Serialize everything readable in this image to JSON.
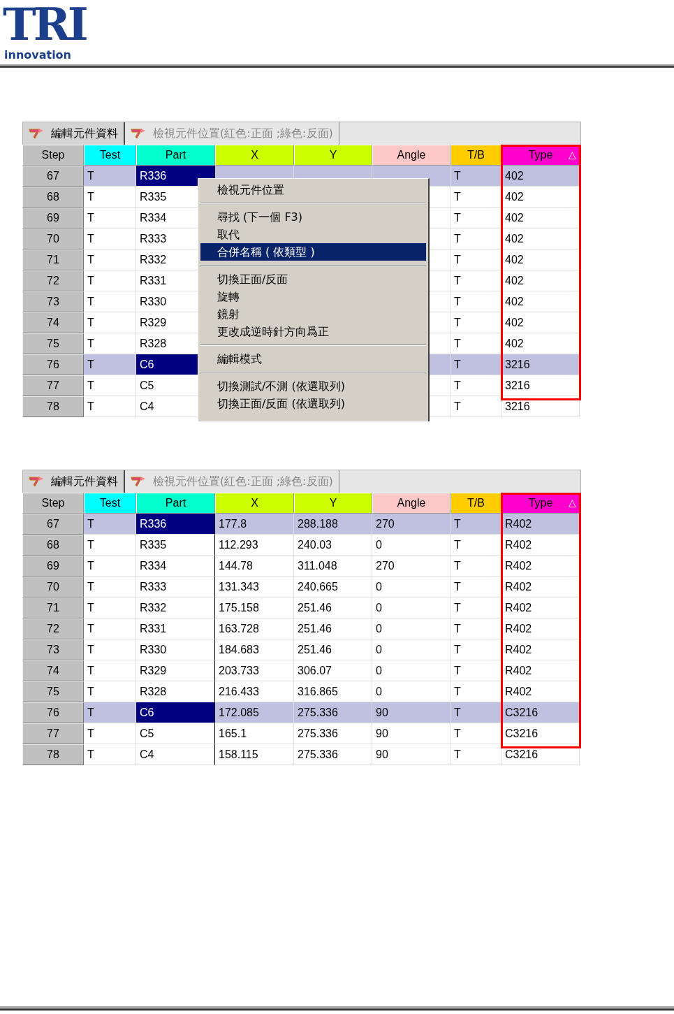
{
  "logo": {
    "mark": "TRI",
    "subtitle": "innovation"
  },
  "panels": [
    {
      "tabs": [
        {
          "label": "編輯元件資料",
          "selected": true
        },
        {
          "label": "檢視元件位置(紅色:正面 ;綠色:反面)",
          "selected": false
        }
      ],
      "columns": [
        {
          "label": "Step",
          "color": "#c0c0c0",
          "highlighted": false
        },
        {
          "label": "Test",
          "color": "#00ffff",
          "highlighted": false
        },
        {
          "label": "Part",
          "color": "#00ffcc",
          "highlighted": false
        },
        {
          "label": "X",
          "color": "#ccff00",
          "highlighted": false
        },
        {
          "label": "Y",
          "color": "#ccff00",
          "highlighted": false
        },
        {
          "label": "Angle",
          "color": "#ffc8c8",
          "highlighted": false
        },
        {
          "label": "T/B",
          "color": "#ffcc00",
          "highlighted": false
        },
        {
          "label": "Type",
          "color": "#ff00cc",
          "highlighted": true,
          "sort_mark": "△"
        }
      ],
      "rows": [
        {
          "selected": true,
          "cells": [
            "67",
            "T",
            "R336",
            "",
            "",
            "",
            "T",
            "402"
          ]
        },
        {
          "selected": false,
          "cells": [
            "68",
            "T",
            "R335",
            "",
            "",
            "",
            "T",
            "402"
          ]
        },
        {
          "selected": false,
          "cells": [
            "69",
            "T",
            "R334",
            "",
            "",
            "",
            "T",
            "402"
          ]
        },
        {
          "selected": false,
          "cells": [
            "70",
            "T",
            "R333",
            "",
            "",
            "",
            "T",
            "402"
          ]
        },
        {
          "selected": false,
          "cells": [
            "71",
            "T",
            "R332",
            "",
            "",
            "",
            "T",
            "402"
          ]
        },
        {
          "selected": false,
          "cells": [
            "72",
            "T",
            "R331",
            "",
            "",
            "",
            "T",
            "402"
          ]
        },
        {
          "selected": false,
          "cells": [
            "73",
            "T",
            "R330",
            "",
            "",
            "",
            "T",
            "402"
          ]
        },
        {
          "selected": false,
          "cells": [
            "74",
            "T",
            "R329",
            "",
            "",
            "",
            "T",
            "402"
          ]
        },
        {
          "selected": false,
          "cells": [
            "75",
            "T",
            "R328",
            "",
            "",
            "",
            "T",
            "402"
          ]
        },
        {
          "selected": true,
          "cells": [
            "76",
            "T",
            "C6",
            "",
            "",
            "",
            "T",
            "3216"
          ]
        },
        {
          "selected": false,
          "cells": [
            "77",
            "T",
            "C5",
            "",
            "",
            "",
            "T",
            "3216"
          ]
        },
        {
          "selected": false,
          "cells": [
            "78",
            "T",
            "C4",
            "",
            "",
            "",
            "T",
            "3216"
          ]
        }
      ],
      "context_menu": {
        "items": [
          {
            "kind": "item",
            "label": "檢視元件位置",
            "selected": false
          },
          {
            "kind": "separator"
          },
          {
            "kind": "item",
            "label": "尋找 (下一個  F3)",
            "selected": false
          },
          {
            "kind": "item",
            "label": "取代",
            "selected": false
          },
          {
            "kind": "item",
            "label": "合併名稱 ( 依類型 )",
            "selected": true
          },
          {
            "kind": "separator"
          },
          {
            "kind": "item",
            "label": "切換正面/反面",
            "selected": false
          },
          {
            "kind": "item",
            "label": "旋轉",
            "selected": false
          },
          {
            "kind": "item",
            "label": "鏡射",
            "selected": false
          },
          {
            "kind": "item",
            "label": "更改成逆時針方向爲正",
            "selected": false
          },
          {
            "kind": "separator"
          },
          {
            "kind": "item",
            "label": "編輯模式",
            "selected": false
          },
          {
            "kind": "separator"
          },
          {
            "kind": "item",
            "label": "切換測試/不測 (依選取列)",
            "selected": false
          },
          {
            "kind": "item",
            "label": "切換正面/反面 (依選取列)",
            "selected": false
          }
        ]
      }
    },
    {
      "tabs": [
        {
          "label": "編輯元件資料",
          "selected": true
        },
        {
          "label": "檢視元件位置(紅色:正面 ;綠色:反面)",
          "selected": false
        }
      ],
      "columns": [
        {
          "label": "Step",
          "color": "#c0c0c0",
          "highlighted": false
        },
        {
          "label": "Test",
          "color": "#00ffff",
          "highlighted": false
        },
        {
          "label": "Part",
          "color": "#00ffcc",
          "highlighted": false
        },
        {
          "label": "X",
          "color": "#ccff00",
          "highlighted": false
        },
        {
          "label": "Y",
          "color": "#ccff00",
          "highlighted": false
        },
        {
          "label": "Angle",
          "color": "#ffc8c8",
          "highlighted": false
        },
        {
          "label": "T/B",
          "color": "#ffcc00",
          "highlighted": false
        },
        {
          "label": "Type",
          "color": "#ff00cc",
          "highlighted": true,
          "sort_mark": "△"
        }
      ],
      "rows": [
        {
          "selected": true,
          "cells": [
            "67",
            "T",
            "R336",
            "177.8",
            "288.188",
            "270",
            "T",
            "R402"
          ]
        },
        {
          "selected": false,
          "cells": [
            "68",
            "T",
            "R335",
            "112.293",
            "240.03",
            "0",
            "T",
            "R402"
          ]
        },
        {
          "selected": false,
          "cells": [
            "69",
            "T",
            "R334",
            "144.78",
            "311.048",
            "270",
            "T",
            "R402"
          ]
        },
        {
          "selected": false,
          "cells": [
            "70",
            "T",
            "R333",
            "131.343",
            "240.665",
            "0",
            "T",
            "R402"
          ]
        },
        {
          "selected": false,
          "cells": [
            "71",
            "T",
            "R332",
            "175.158",
            "251.46",
            "0",
            "T",
            "R402"
          ]
        },
        {
          "selected": false,
          "cells": [
            "72",
            "T",
            "R331",
            "163.728",
            "251.46",
            "0",
            "T",
            "R402"
          ]
        },
        {
          "selected": false,
          "cells": [
            "73",
            "T",
            "R330",
            "184.683",
            "251.46",
            "0",
            "T",
            "R402"
          ]
        },
        {
          "selected": false,
          "cells": [
            "74",
            "T",
            "R329",
            "203.733",
            "306.07",
            "0",
            "T",
            "R402"
          ]
        },
        {
          "selected": false,
          "cells": [
            "75",
            "T",
            "R328",
            "216.433",
            "316.865",
            "0",
            "T",
            "R402"
          ]
        },
        {
          "selected": true,
          "cells": [
            "76",
            "T",
            "C6",
            "172.085",
            "275.336",
            "90",
            "T",
            "C3216"
          ]
        },
        {
          "selected": false,
          "cells": [
            "77",
            "T",
            "C5",
            "165.1",
            "275.336",
            "90",
            "T",
            "C3216"
          ]
        },
        {
          "selected": false,
          "cells": [
            "78",
            "T",
            "C4",
            "158.115",
            "275.336",
            "90",
            "T",
            "C3216"
          ]
        }
      ]
    }
  ]
}
